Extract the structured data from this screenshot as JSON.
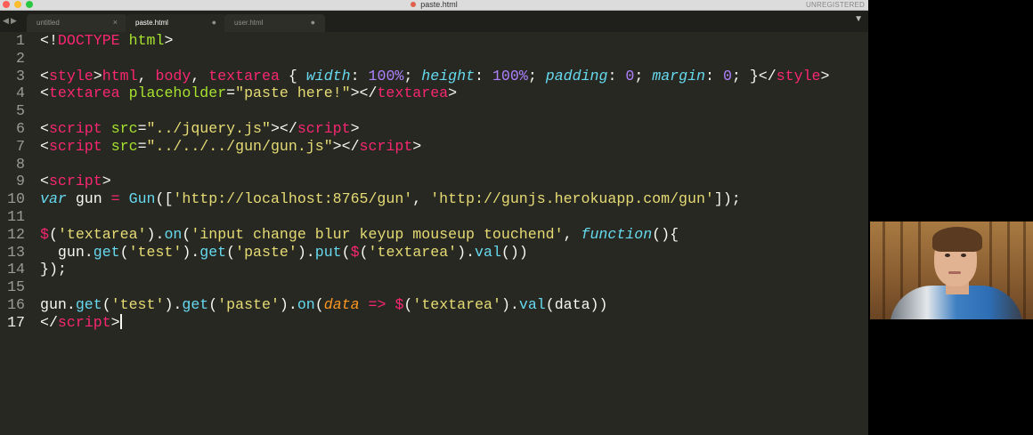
{
  "window": {
    "title": "paste.html",
    "status": "UNREGISTERED",
    "nav": {
      "back_icon": "◀",
      "forward_icon": "▶"
    },
    "tab_menu_icon": "▼"
  },
  "tabs": [
    {
      "label": "untitled",
      "button": "×",
      "button_icon": "close-icon",
      "active": false
    },
    {
      "label": "paste.html",
      "button": "●",
      "button_icon": "modified-dot-icon",
      "active": true
    },
    {
      "label": "user.html",
      "button": "●",
      "button_icon": "modified-dot-icon",
      "active": false
    }
  ],
  "editor": {
    "language": "html",
    "current_line": 17,
    "colors": {
      "background": "#272822",
      "tag": "#f92672",
      "string": "#e6db74",
      "attribute": "#a6e22e",
      "keyword": "#66d9ef",
      "number": "#ae81ff",
      "param": "#fd971f"
    },
    "lines": [
      {
        "n": "1",
        "tokens": [
          [
            "p",
            "<!"
          ],
          [
            "t",
            "DOCTYPE"
          ],
          [
            "p",
            " "
          ],
          [
            "a",
            "html"
          ],
          [
            "p",
            ">"
          ]
        ]
      },
      {
        "n": "2",
        "tokens": []
      },
      {
        "n": "3",
        "tokens": [
          [
            "p",
            "<"
          ],
          [
            "t",
            "style"
          ],
          [
            "p",
            ">"
          ],
          [
            "t",
            "html"
          ],
          [
            "p",
            ", "
          ],
          [
            "t",
            "body"
          ],
          [
            "p",
            ", "
          ],
          [
            "t",
            "textarea"
          ],
          [
            "p",
            " { "
          ],
          [
            "f",
            "width"
          ],
          [
            "p",
            ": "
          ],
          [
            "n",
            "100%"
          ],
          [
            "p",
            "; "
          ],
          [
            "f",
            "height"
          ],
          [
            "p",
            ": "
          ],
          [
            "n",
            "100%"
          ],
          [
            "p",
            "; "
          ],
          [
            "f",
            "padding"
          ],
          [
            "p",
            ": "
          ],
          [
            "n",
            "0"
          ],
          [
            "p",
            "; "
          ],
          [
            "f",
            "margin"
          ],
          [
            "p",
            ": "
          ],
          [
            "n",
            "0"
          ],
          [
            "p",
            "; }</"
          ],
          [
            "t",
            "style"
          ],
          [
            "p",
            ">"
          ]
        ]
      },
      {
        "n": "4",
        "tokens": [
          [
            "p",
            "<"
          ],
          [
            "t",
            "textarea"
          ],
          [
            "p",
            " "
          ],
          [
            "a",
            "placeholder"
          ],
          [
            "p",
            "="
          ],
          [
            "s",
            "\"paste here!\""
          ],
          [
            "p",
            "></"
          ],
          [
            "t",
            "textarea"
          ],
          [
            "p",
            ">"
          ]
        ]
      },
      {
        "n": "5",
        "tokens": []
      },
      {
        "n": "6",
        "tokens": [
          [
            "p",
            "<"
          ],
          [
            "t",
            "script"
          ],
          [
            "p",
            " "
          ],
          [
            "a",
            "src"
          ],
          [
            "p",
            "="
          ],
          [
            "s",
            "\"../jquery.js\""
          ],
          [
            "p",
            "></"
          ],
          [
            "t",
            "script"
          ],
          [
            "p",
            ">"
          ]
        ]
      },
      {
        "n": "7",
        "tokens": [
          [
            "p",
            "<"
          ],
          [
            "t",
            "script"
          ],
          [
            "p",
            " "
          ],
          [
            "a",
            "src"
          ],
          [
            "p",
            "="
          ],
          [
            "s",
            "\"../../../gun/gun.js\""
          ],
          [
            "p",
            "></"
          ],
          [
            "t",
            "script"
          ],
          [
            "p",
            ">"
          ]
        ]
      },
      {
        "n": "8",
        "tokens": []
      },
      {
        "n": "9",
        "tokens": [
          [
            "p",
            "<"
          ],
          [
            "t",
            "script"
          ],
          [
            "p",
            ">"
          ]
        ]
      },
      {
        "n": "10",
        "tokens": [
          [
            "f",
            "var"
          ],
          [
            "p",
            " gun "
          ],
          [
            "t",
            "="
          ],
          [
            "p",
            " "
          ],
          [
            "m",
            "Gun"
          ],
          [
            "p",
            "(["
          ],
          [
            "s",
            "'http://localhost:8765/gun'"
          ],
          [
            "p",
            ", "
          ],
          [
            "s",
            "'http://gunjs.herokuapp.com/gun'"
          ],
          [
            "p",
            "]);"
          ]
        ]
      },
      {
        "n": "11",
        "tokens": []
      },
      {
        "n": "12",
        "tokens": [
          [
            "t",
            "$"
          ],
          [
            "p",
            "("
          ],
          [
            "s",
            "'textarea'"
          ],
          [
            "p",
            ")."
          ],
          [
            "m",
            "on"
          ],
          [
            "p",
            "("
          ],
          [
            "s",
            "'input change blur keyup mouseup touchend'"
          ],
          [
            "p",
            ", "
          ],
          [
            "f",
            "function"
          ],
          [
            "p",
            "(){"
          ]
        ]
      },
      {
        "n": "13",
        "tokens": [
          [
            "p",
            "  gun."
          ],
          [
            "m",
            "get"
          ],
          [
            "p",
            "("
          ],
          [
            "s",
            "'test'"
          ],
          [
            "p",
            ")."
          ],
          [
            "m",
            "get"
          ],
          [
            "p",
            "("
          ],
          [
            "s",
            "'paste'"
          ],
          [
            "p",
            ")."
          ],
          [
            "m",
            "put"
          ],
          [
            "p",
            "("
          ],
          [
            "t",
            "$"
          ],
          [
            "p",
            "("
          ],
          [
            "s",
            "'textarea'"
          ],
          [
            "p",
            ")."
          ],
          [
            "m",
            "val"
          ],
          [
            "p",
            "())"
          ]
        ]
      },
      {
        "n": "14",
        "tokens": [
          [
            "p",
            "});"
          ]
        ]
      },
      {
        "n": "15",
        "tokens": []
      },
      {
        "n": "16",
        "tokens": [
          [
            "p",
            "gun."
          ],
          [
            "m",
            "get"
          ],
          [
            "p",
            "("
          ],
          [
            "s",
            "'test'"
          ],
          [
            "p",
            ")."
          ],
          [
            "m",
            "get"
          ],
          [
            "p",
            "("
          ],
          [
            "s",
            "'paste'"
          ],
          [
            "p",
            ")."
          ],
          [
            "m",
            "on"
          ],
          [
            "p",
            "("
          ],
          [
            "P",
            "data"
          ],
          [
            "p",
            " "
          ],
          [
            "t",
            "=>"
          ],
          [
            "p",
            " "
          ],
          [
            "t",
            "$"
          ],
          [
            "p",
            "("
          ],
          [
            "s",
            "'textarea'"
          ],
          [
            "p",
            ")."
          ],
          [
            "m",
            "val"
          ],
          [
            "p",
            "(data))"
          ]
        ]
      },
      {
        "n": "17",
        "tokens": [
          [
            "p",
            "</"
          ],
          [
            "t",
            "script"
          ],
          [
            "p",
            ">"
          ]
        ]
      }
    ]
  },
  "webcam": {
    "content": "presenter-video"
  }
}
